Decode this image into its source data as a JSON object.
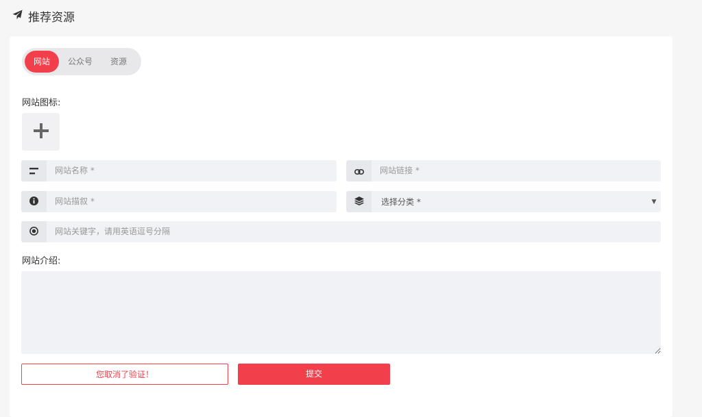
{
  "header": {
    "title": "推荐资源",
    "icon": "paper-plane-icon"
  },
  "tabs": [
    {
      "label": "网站",
      "active": true
    },
    {
      "label": "公众号",
      "active": false
    },
    {
      "label": "资源",
      "active": false
    }
  ],
  "form": {
    "icon_label": "网站图标:",
    "name_placeholder": "网站名称 *",
    "link_placeholder": "网站链接 *",
    "desc_placeholder": "网站描叙 *",
    "category_selected": "选择分类 *",
    "keywords_placeholder": "网站关键字，请用英语逗号分隔",
    "intro_label": "网站介绍:",
    "verify_label": "您取消了验证！",
    "submit_label": "提交"
  },
  "colors": {
    "accent": "#f1404b"
  }
}
